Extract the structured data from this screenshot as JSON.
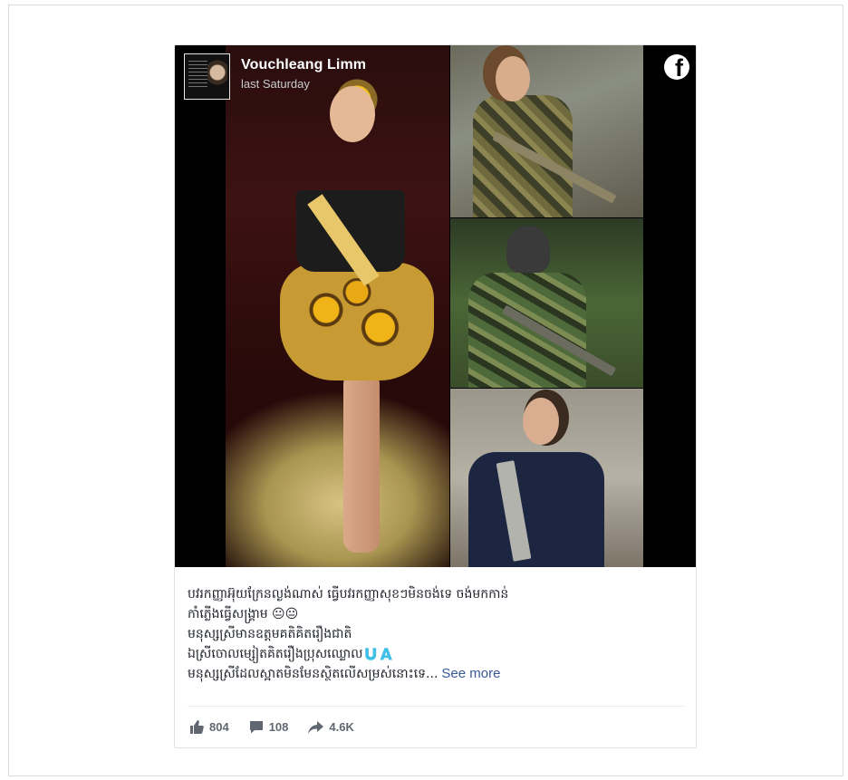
{
  "post": {
    "author": "Vouchleang Limm",
    "time": "last Saturday",
    "brand_icon": "facebook-icon",
    "text_lines": [
      "បវរកញ្ញាអ៊ុយក្រែនល្ងង់ណាស់ ធ្វើបវរកញ្ញាសុខៗមិនចង់ទេ ចង់មកកាន់",
      "កាំភ្លើងធ្វើសង្គ្រាម 😐😐",
      "មនុស្សស្រីមានឧត្តមគតិគិតរឿងជាតិ",
      "ឯស្រីចោលម្សៀតគិតរឿងប្រុសឈ្លោល🇺🇦",
      "មនុស្សស្រីដែលស្អាតមិនមែនស្ថិតលើសម្រស់នោះទេ..."
    ],
    "see_more": "See more",
    "stats": {
      "likes": "804",
      "comments": "108",
      "shares": "4.6K"
    }
  }
}
